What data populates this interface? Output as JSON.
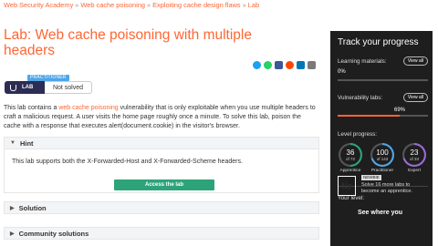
{
  "breadcrumb": [
    "Web Security Academy",
    "Web cache poisoning",
    "Exploiting cache design flaws",
    "Lab"
  ],
  "title": "Lab: Web cache poisoning with multiple headers",
  "level_badge": "PRACTITIONER",
  "lab_badge": "LAB",
  "status": "Not solved",
  "description": {
    "pre": "This lab contains a ",
    "link": "web cache poisoning",
    "post": " vulnerability that is only exploitable when you use multiple headers to craft a malicious request. A user visits the home page roughly once a minute. To solve this lab, poison the cache with a response that executes  alert(document.cookie)  in the visitor's browser."
  },
  "hint": {
    "label": "Hint",
    "text": "This lab supports both the  X-Forwarded-Host  and  X-Forwarded-Scheme  headers."
  },
  "access_button": "Access the lab",
  "solution_label": "Solution",
  "community_label": "Community solutions",
  "sidebar": {
    "title": "Track your progress",
    "learning_label": "Learning materials:",
    "learning_pct": "0%",
    "learning_fraction": 0.0,
    "labs_label": "Vulnerability labs:",
    "labs_pct": "69%",
    "labs_fraction": 0.69,
    "view_all": "View all",
    "level_label": "Level progress:",
    "circles": [
      {
        "num": "36",
        "den": "of 72",
        "label": "Apprentice",
        "color": "#2da37a",
        "fraction": 0.5
      },
      {
        "num": "100",
        "den": "of 143",
        "label": "Practitioner",
        "color": "#4fa6e8",
        "fraction": 0.7
      },
      {
        "num": "23",
        "den": "of 33",
        "label": "Expert",
        "color": "#9b6ad6",
        "fraction": 0.7
      }
    ],
    "your_level_label": "Your level:",
    "level_symbol": "Ne",
    "level_name": "NEWBIE",
    "level_text": "Solve 16 more labs to become an apprentice.",
    "see_where": "See where you"
  },
  "share_icons": [
    {
      "name": "twitter-icon",
      "color": "#1da1f2"
    },
    {
      "name": "whatsapp-icon",
      "color": "#25d366"
    },
    {
      "name": "facebook-icon",
      "color": "#3b5998"
    },
    {
      "name": "reddit-icon",
      "color": "#ff4500"
    },
    {
      "name": "linkedin-icon",
      "color": "#0077b5"
    },
    {
      "name": "email-icon",
      "color": "#7a7a7a"
    }
  ]
}
